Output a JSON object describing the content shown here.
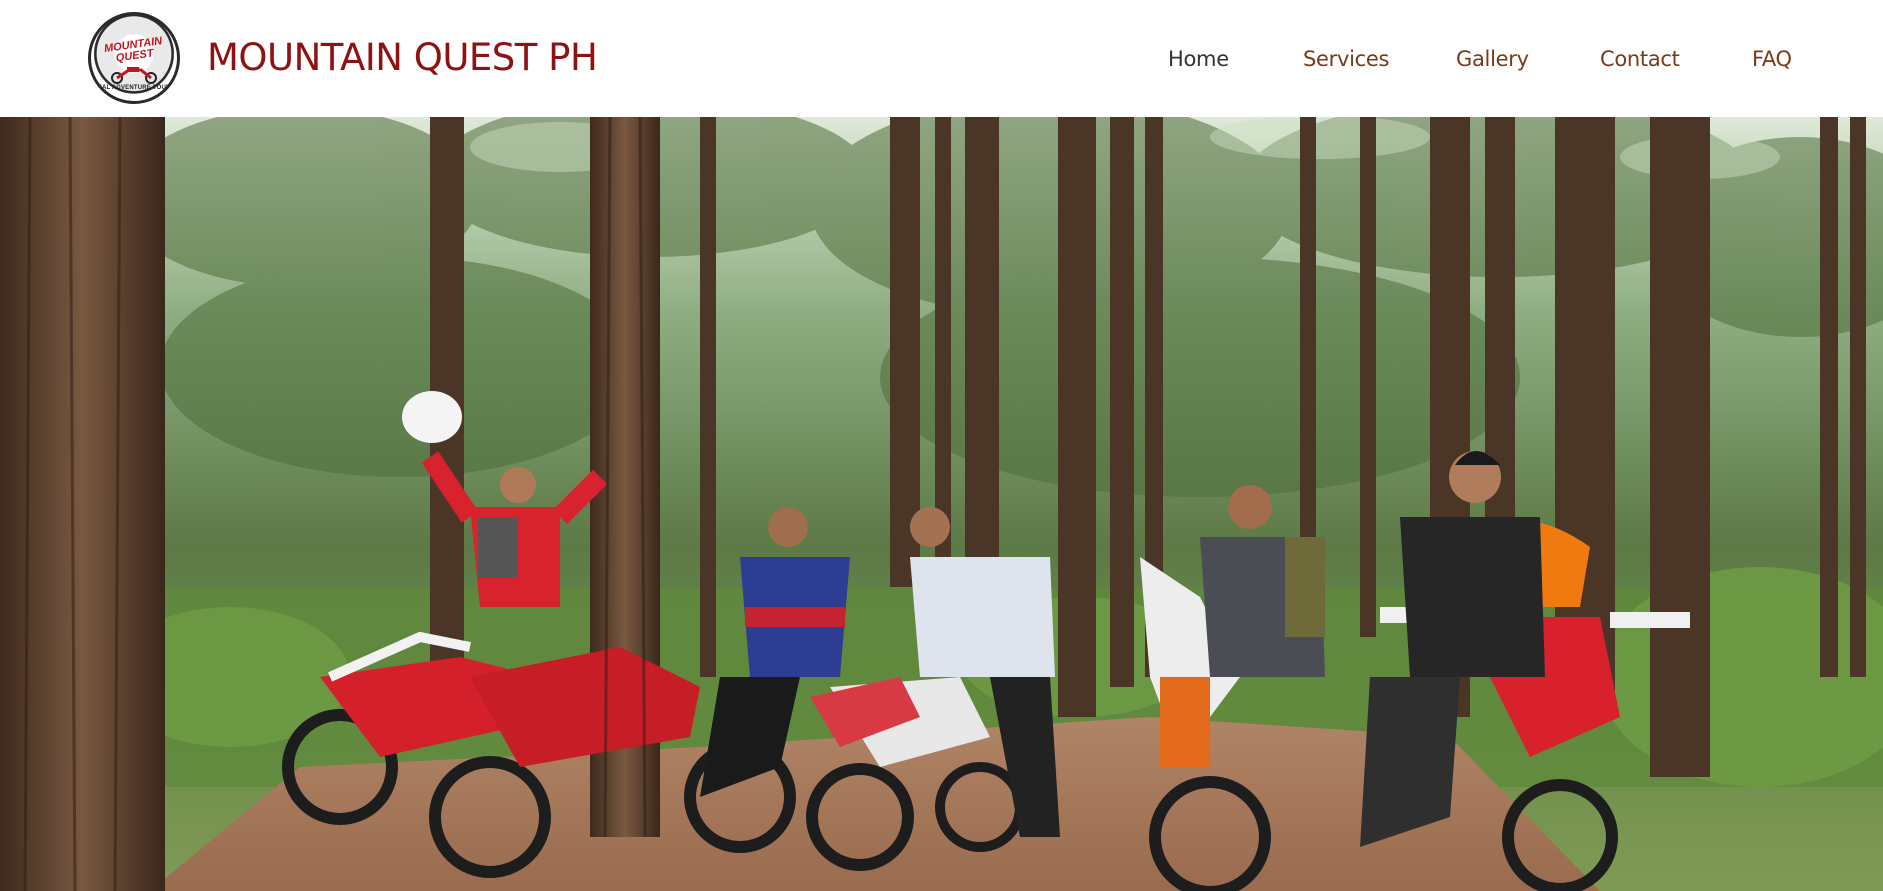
{
  "header": {
    "brand_title": "MOUNTAIN QUEST PH",
    "logo": {
      "top_text": "MOUNTAIN QUEST",
      "bottom_text": "REAL ADVENTURE TOURS"
    }
  },
  "nav": {
    "items": [
      {
        "label": "Home",
        "active": true
      },
      {
        "label": "Services",
        "active": false
      },
      {
        "label": "Gallery",
        "active": false
      },
      {
        "label": "Contact",
        "active": false
      },
      {
        "label": "FAQ",
        "active": false
      }
    ]
  },
  "hero": {
    "image_description_icon": "photo-icon"
  },
  "colors": {
    "brand": "#8e1212",
    "nav_link": "#7a3a14",
    "nav_active": "#333333",
    "header_bg": "#ffffff"
  }
}
